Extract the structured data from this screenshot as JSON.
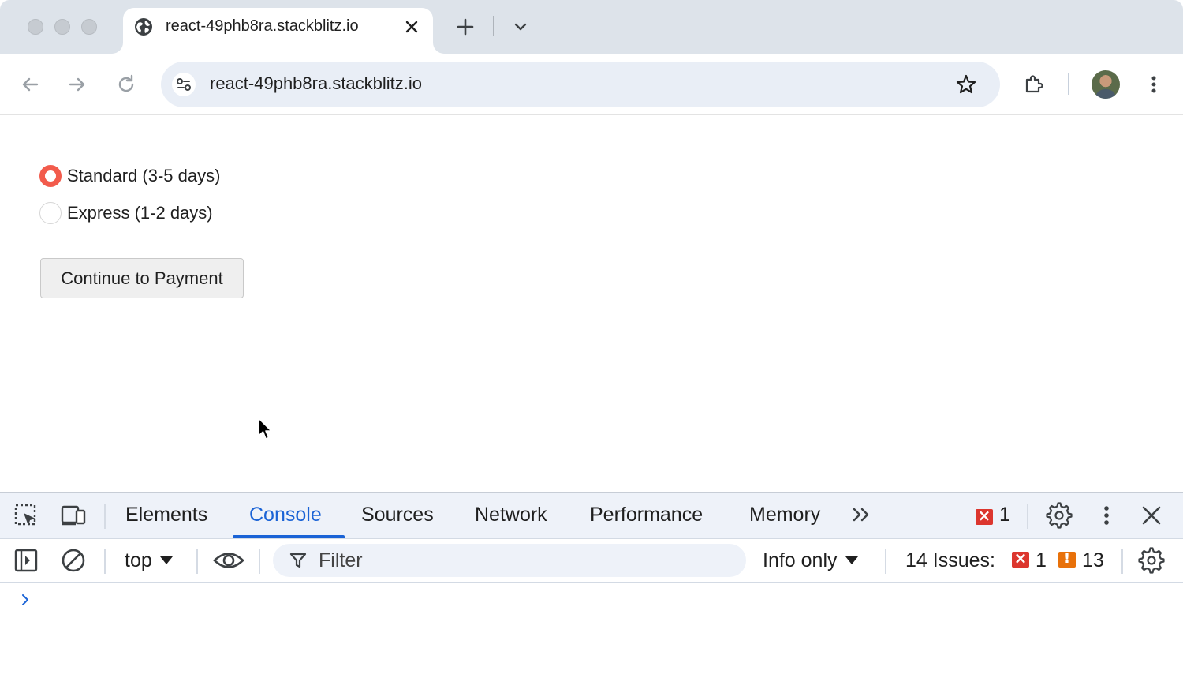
{
  "browser": {
    "tab": {
      "title": "react-49phb8ra.stackblitz.io",
      "favicon": "globe-icon"
    },
    "address_bar": {
      "url": "react-49phb8ra.stackblitz.io"
    }
  },
  "page": {
    "shipping_options": [
      {
        "label": "Standard (3-5 days)",
        "checked": true
      },
      {
        "label": "Express (1-2 days)",
        "checked": false
      }
    ],
    "continue_button": "Continue to Payment"
  },
  "devtools": {
    "tabs": [
      "Elements",
      "Console",
      "Sources",
      "Network",
      "Performance",
      "Memory"
    ],
    "active_tab": "Console",
    "error_count": "1",
    "console": {
      "context": "top",
      "filter_placeholder": "Filter",
      "levels": "Info only",
      "issues_label": "14 Issues:",
      "issues_errors": "1",
      "issues_warnings": "13"
    }
  },
  "colors": {
    "radio_accent": "#f25b4c",
    "devtools_active": "#1a63d6",
    "error": "#dc362e",
    "warning": "#e8710a"
  }
}
